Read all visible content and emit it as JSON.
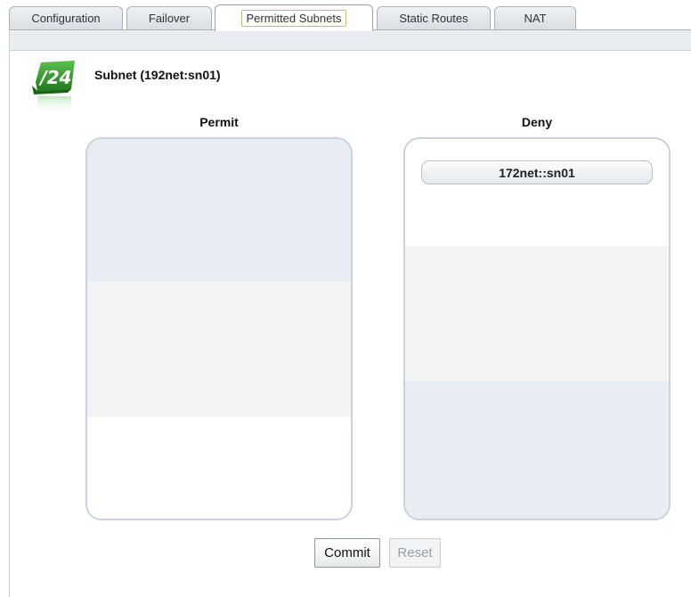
{
  "tabs": [
    {
      "label": "Configuration",
      "active": false
    },
    {
      "label": "Failover",
      "active": false
    },
    {
      "label": "Permitted Subnets",
      "active": true
    },
    {
      "label": "Static Routes",
      "active": false
    },
    {
      "label": "NAT",
      "active": false
    }
  ],
  "subnet": {
    "icon_text": "/24",
    "icon": "subnet-network-icon",
    "title": "Subnet (192net:sn01)"
  },
  "permit": {
    "heading": "Permit",
    "items": []
  },
  "deny": {
    "heading": "Deny",
    "items": [
      "172net::sn01"
    ]
  },
  "buttons": {
    "commit": "Commit",
    "reset": "Reset"
  },
  "colors": {
    "active_tab_highlight": "#e3b24a",
    "icon_green": "#2f9a2a",
    "band_blue": "#e8ecf3",
    "band_gray": "#f3f4f6"
  }
}
